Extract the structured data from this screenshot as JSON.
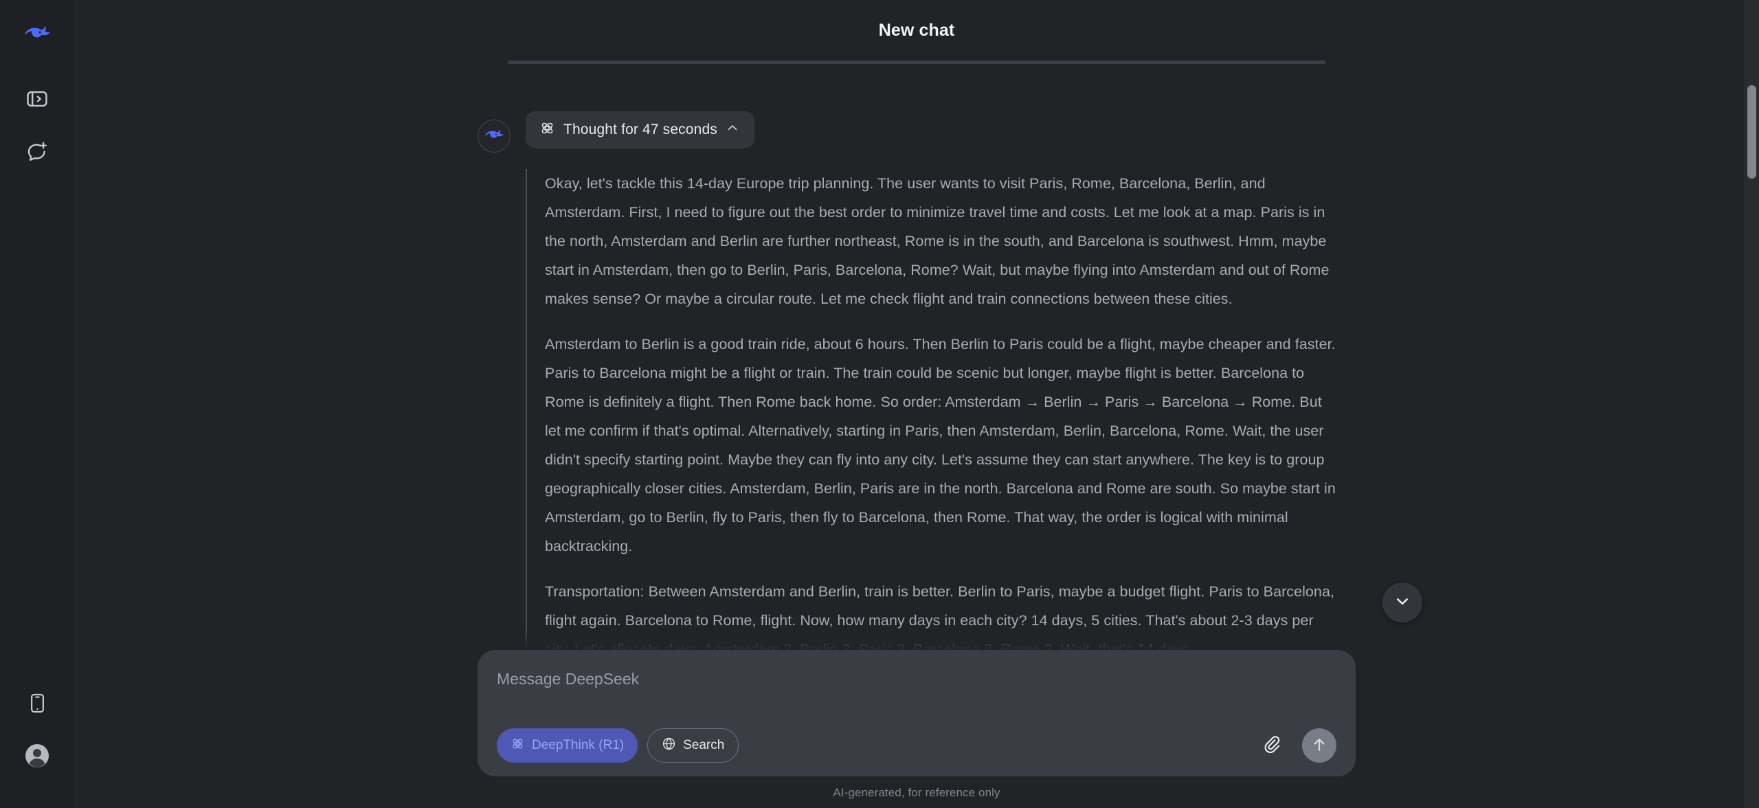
{
  "app": {
    "name": "DeepSeek",
    "accent": "#4d6bfe",
    "background": "#222327",
    "sidebar_background": "#1f2023",
    "thinking_text_color": "#a8abb4"
  },
  "sidebar": {
    "logo_name": "deepseek-whale-logo",
    "top_items": [
      {
        "name": "expand-sidebar",
        "icon": "panel-expand-icon",
        "label": "Expand sidebar"
      },
      {
        "name": "new-chat",
        "icon": "new-chat-icon",
        "label": "New chat"
      }
    ],
    "bottom_items": [
      {
        "name": "get-app",
        "icon": "mobile-device-icon",
        "label": "Get App"
      },
      {
        "name": "profile",
        "icon": "user-avatar-icon",
        "label": "My Profile"
      }
    ]
  },
  "header": {
    "title": "New chat"
  },
  "conversation": {
    "assistant": {
      "avatar_icon": "deepseek-whale-avatar",
      "thought_chip": {
        "icon": "deepthink-atom-icon",
        "label": "Thought for 47 seconds",
        "chevron": "chevron-up-icon",
        "expanded": true
      },
      "thinking_paragraphs": [
        "Okay, let's tackle this 14-day Europe trip planning. The user wants to visit Paris, Rome, Barcelona, Berlin, and Amsterdam. First, I need to figure out the best order to minimize travel time and costs. Let me look at a map. Paris is in the north, Amsterdam and Berlin are further northeast, Rome is in the south, and Barcelona is southwest. Hmm, maybe start in Amsterdam, then go to Berlin, Paris, Barcelona, Rome? Wait, but maybe flying into Amsterdam and out of Rome makes sense? Or maybe a circular route. Let me check flight and train connections between these cities.",
        "Amsterdam to Berlin is a good train ride, about 6 hours. Then Berlin to Paris could be a flight, maybe cheaper and faster. Paris to Barcelona might be a flight or train. The train could be scenic but longer, maybe flight is better. Barcelona to Rome is definitely a flight. Then Rome back home. So order: Amsterdam → Berlin → Paris → Barcelona → Rome. But let me confirm if that's optimal. Alternatively, starting in Paris, then Amsterdam, Berlin, Barcelona, Rome. Wait, the user didn't specify starting point. Maybe they can fly into any city. Let's assume they can start anywhere. The key is to group geographically closer cities. Amsterdam, Berlin, Paris are in the north. Barcelona and Rome are south. So maybe start in Amsterdam, go to Berlin, fly to Paris, then fly to Barcelona, then Rome. That way, the order is logical with minimal backtracking.",
        "Transportation: Between Amsterdam and Berlin, train is better. Berlin to Paris, maybe a budget flight. Paris to Barcelona, flight again. Barcelona to Rome, flight. Now, how many days in each city? 14 days, 5 cities. That's about 2-3 days per city. Let's allocate days: Amsterdam 3, Berlin 3, Paris 3, Barcelona 3, Rome 3. Wait, that's 14 days"
      ]
    },
    "scroll_to_bottom": {
      "name": "scroll-to-bottom-button",
      "icon": "chevron-down-icon"
    }
  },
  "composer": {
    "placeholder": "Message DeepSeek",
    "value": "",
    "tools": [
      {
        "name": "deepthink-toggle",
        "label": "DeepThink (R1)",
        "icon": "atom-icon",
        "active": true,
        "color": "#93a8f4"
      },
      {
        "name": "search-toggle",
        "label": "Search",
        "icon": "globe-icon",
        "active": false
      }
    ],
    "attach": {
      "name": "attach-file-button",
      "icon": "paperclip-icon"
    },
    "send": {
      "name": "send-message-button",
      "icon": "arrow-up-icon",
      "enabled": false
    }
  },
  "footer": {
    "note": "AI-generated, for reference only"
  },
  "scrollbar": {
    "name": "vertical-scrollbar",
    "thumb_top_pct": 10.5,
    "thumb_height_pct": 11.6
  }
}
